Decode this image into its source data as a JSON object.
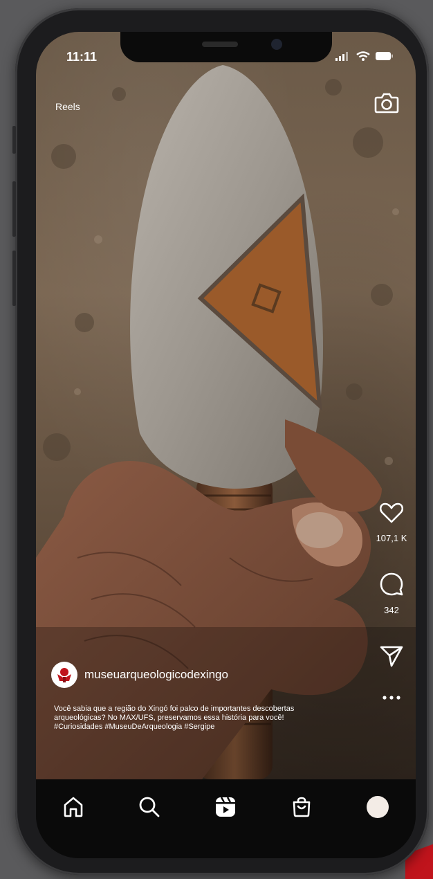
{
  "status_bar": {
    "time": "11:11"
  },
  "header": {
    "title": "Reels",
    "camera_icon": "camera-icon"
  },
  "actions": {
    "like_icon": "heart-icon",
    "like_count": "107,1 K",
    "comment_icon": "comment-icon",
    "comment_count": "342",
    "share_icon": "send-icon",
    "more_icon": "more-icon"
  },
  "post": {
    "username": "museuarqueologicodexingo",
    "caption_lines": [
      "Você sabia que a região do Xingó foi palco de importantes descobertas",
      "arqueológicas? No MAX/UFS, preservamos essa história para você!",
      "#Curiosidades #MuseuDeArqueologia #Sergipe"
    ]
  },
  "navbar": {
    "items": [
      "home-icon",
      "search-icon",
      "reels-icon",
      "shop-icon",
      "profile-avatar"
    ]
  },
  "colors": {
    "brand_accent": "#c0141c",
    "navbar_bg": "#0a0a0a",
    "text": "#ffffff"
  }
}
